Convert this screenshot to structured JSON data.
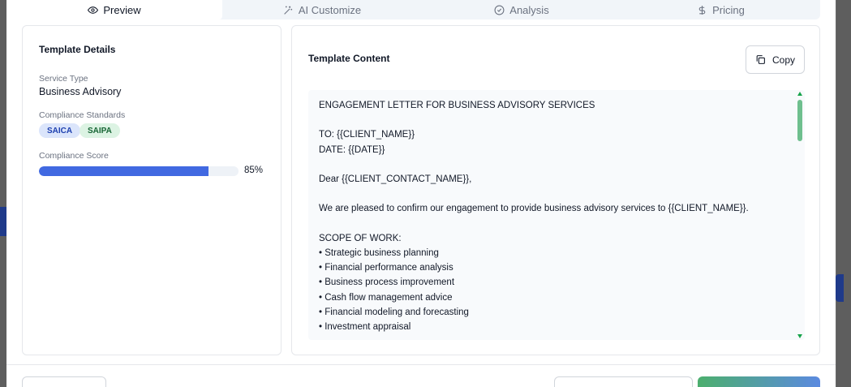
{
  "tabs": [
    {
      "label": "Preview",
      "icon": "eye-icon",
      "active": true
    },
    {
      "label": "AI Customize",
      "icon": "magic-wand-icon",
      "active": false
    },
    {
      "label": "Analysis",
      "icon": "check-circle-icon",
      "active": false
    },
    {
      "label": "Pricing",
      "icon": "dollar-icon",
      "active": false
    }
  ],
  "details": {
    "title": "Template Details",
    "service_type_label": "Service Type",
    "service_type": "Business Advisory",
    "compliance_label": "Compliance Standards",
    "standards": [
      "SAICA",
      "SAIPA"
    ],
    "score_label": "Compliance Score",
    "score_value": 0.85,
    "score_text": "85%"
  },
  "content": {
    "title": "Template Content",
    "copy_label": "Copy",
    "lines": [
      "ENGAGEMENT LETTER FOR BUSINESS ADVISORY SERVICES",
      "",
      "TO: {{CLIENT_NAME}}",
      "DATE: {{DATE}}",
      "",
      "Dear {{CLIENT_CONTACT_NAME}},",
      "",
      "We are pleased to confirm our engagement to provide business advisory services to {{CLIENT_NAME}}.",
      "",
      "SCOPE OF WORK:",
      "• Strategic business planning",
      "• Financial performance analysis",
      "• Business process improvement",
      "• Cash flow management advice",
      "• Financial modeling and forecasting",
      "• Investment appraisal"
    ]
  },
  "colors": {
    "accent": "#4169e1",
    "scroll": "#6fbf8e"
  }
}
